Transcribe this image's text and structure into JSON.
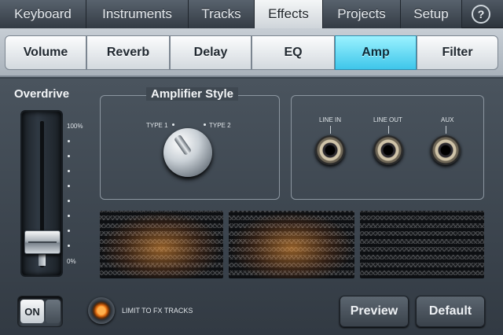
{
  "tabs": [
    "Keyboard",
    "Instruments",
    "Tracks",
    "Effects",
    "Projects",
    "Setup"
  ],
  "active_tab": "Effects",
  "help_label": "?",
  "subtabs": [
    "Volume",
    "Reverb",
    "Delay",
    "EQ",
    "Amp",
    "Filter"
  ],
  "active_subtab": "Amp",
  "overdrive": {
    "title": "Overdrive",
    "max_label": "100%",
    "min_label": "0%",
    "level_percent": 10
  },
  "amplifier_style": {
    "title": "Amplifier Style",
    "type1_label": "TYPE 1",
    "type2_label": "TYPE 2",
    "selected": "TYPE 1"
  },
  "jacks": {
    "line_in": "LINE IN",
    "line_out": "LINE OUT",
    "aux": "AUX"
  },
  "bottom": {
    "toggle_label": "ON",
    "limit_label": "LIMIT TO FX TRACKS",
    "preview_label": "Preview",
    "default_label": "Default"
  },
  "colors": {
    "accent": "#3ec6ea",
    "led": "#ff8a1e"
  }
}
